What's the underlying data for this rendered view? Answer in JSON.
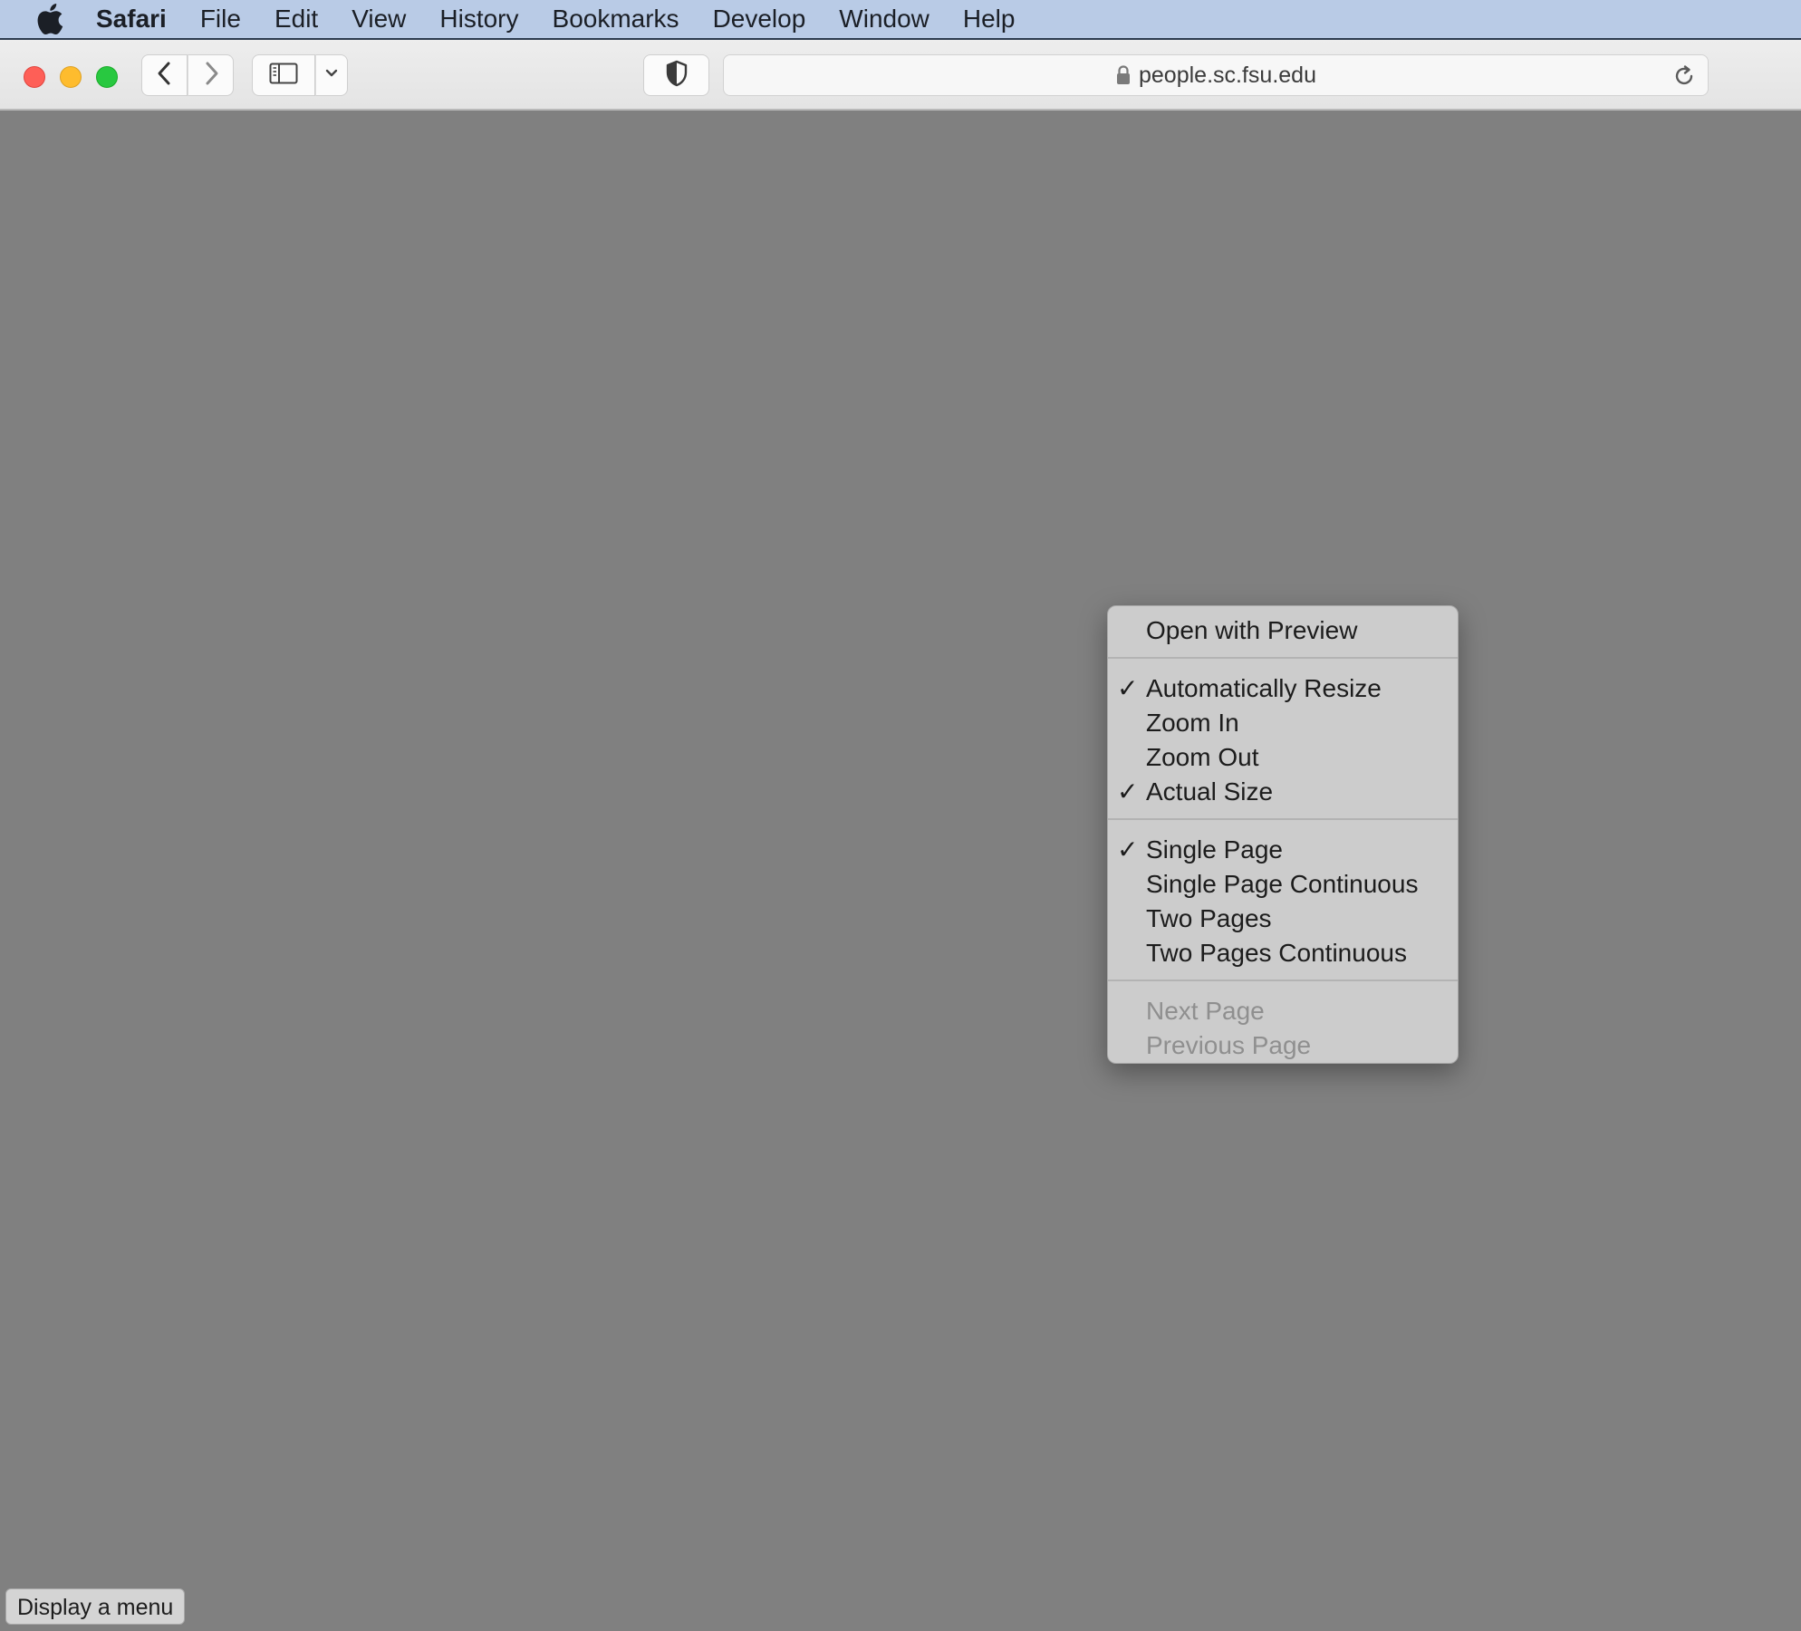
{
  "menubar": {
    "app_name": "Safari",
    "items": [
      "File",
      "Edit",
      "View",
      "History",
      "Bookmarks",
      "Develop",
      "Window",
      "Help"
    ]
  },
  "toolbar": {
    "url": "people.sc.fsu.edu"
  },
  "icons": {
    "apple": "apple-logo-icon",
    "back": "chevron-left-icon",
    "forward": "chevron-right-icon",
    "sidebar": "sidebar-icon",
    "sidebar_menu": "chevron-down-icon",
    "privacy": "shield-icon",
    "lock": "lock-icon",
    "reload": "reload-icon"
  },
  "colors": {
    "menubar_bg": "#b9cbe6",
    "content_bg": "#808080",
    "close": "#fe5f57",
    "minimize": "#febc2e",
    "maximize": "#28c840"
  },
  "context_menu": {
    "open_with_preview": "Open with Preview",
    "automatically_resize": "Automatically Resize",
    "zoom_in": "Zoom In",
    "zoom_out": "Zoom Out",
    "actual_size": "Actual Size",
    "single_page": "Single Page",
    "single_page_continuous": "Single Page Continuous",
    "two_pages": "Two Pages",
    "two_pages_continuous": "Two Pages Continuous",
    "next_page": "Next Page",
    "previous_page": "Previous Page",
    "checkmark": "✓"
  },
  "status": {
    "tooltip": "Display a menu"
  }
}
